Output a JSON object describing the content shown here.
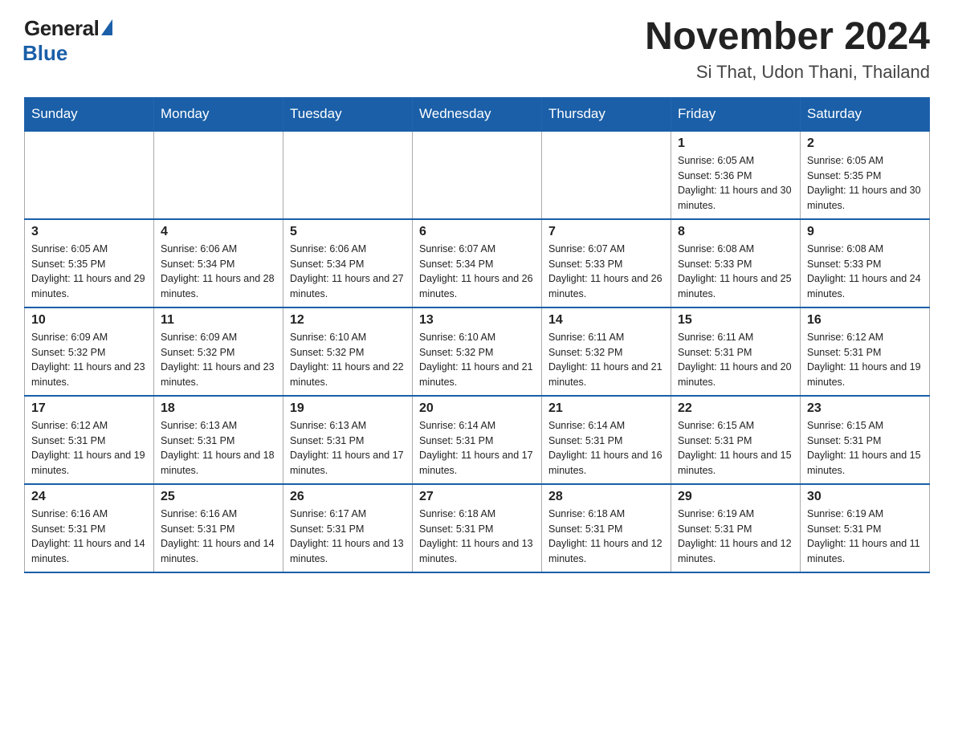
{
  "header": {
    "logo_general": "General",
    "logo_blue": "Blue",
    "month_year": "November 2024",
    "location": "Si That, Udon Thani, Thailand"
  },
  "weekdays": [
    "Sunday",
    "Monday",
    "Tuesday",
    "Wednesday",
    "Thursday",
    "Friday",
    "Saturday"
  ],
  "rows": [
    [
      {
        "day": "",
        "sunrise": "",
        "sunset": "",
        "daylight": ""
      },
      {
        "day": "",
        "sunrise": "",
        "sunset": "",
        "daylight": ""
      },
      {
        "day": "",
        "sunrise": "",
        "sunset": "",
        "daylight": ""
      },
      {
        "day": "",
        "sunrise": "",
        "sunset": "",
        "daylight": ""
      },
      {
        "day": "",
        "sunrise": "",
        "sunset": "",
        "daylight": ""
      },
      {
        "day": "1",
        "sunrise": "Sunrise: 6:05 AM",
        "sunset": "Sunset: 5:36 PM",
        "daylight": "Daylight: 11 hours and 30 minutes."
      },
      {
        "day": "2",
        "sunrise": "Sunrise: 6:05 AM",
        "sunset": "Sunset: 5:35 PM",
        "daylight": "Daylight: 11 hours and 30 minutes."
      }
    ],
    [
      {
        "day": "3",
        "sunrise": "Sunrise: 6:05 AM",
        "sunset": "Sunset: 5:35 PM",
        "daylight": "Daylight: 11 hours and 29 minutes."
      },
      {
        "day": "4",
        "sunrise": "Sunrise: 6:06 AM",
        "sunset": "Sunset: 5:34 PM",
        "daylight": "Daylight: 11 hours and 28 minutes."
      },
      {
        "day": "5",
        "sunrise": "Sunrise: 6:06 AM",
        "sunset": "Sunset: 5:34 PM",
        "daylight": "Daylight: 11 hours and 27 minutes."
      },
      {
        "day": "6",
        "sunrise": "Sunrise: 6:07 AM",
        "sunset": "Sunset: 5:34 PM",
        "daylight": "Daylight: 11 hours and 26 minutes."
      },
      {
        "day": "7",
        "sunrise": "Sunrise: 6:07 AM",
        "sunset": "Sunset: 5:33 PM",
        "daylight": "Daylight: 11 hours and 26 minutes."
      },
      {
        "day": "8",
        "sunrise": "Sunrise: 6:08 AM",
        "sunset": "Sunset: 5:33 PM",
        "daylight": "Daylight: 11 hours and 25 minutes."
      },
      {
        "day": "9",
        "sunrise": "Sunrise: 6:08 AM",
        "sunset": "Sunset: 5:33 PM",
        "daylight": "Daylight: 11 hours and 24 minutes."
      }
    ],
    [
      {
        "day": "10",
        "sunrise": "Sunrise: 6:09 AM",
        "sunset": "Sunset: 5:32 PM",
        "daylight": "Daylight: 11 hours and 23 minutes."
      },
      {
        "day": "11",
        "sunrise": "Sunrise: 6:09 AM",
        "sunset": "Sunset: 5:32 PM",
        "daylight": "Daylight: 11 hours and 23 minutes."
      },
      {
        "day": "12",
        "sunrise": "Sunrise: 6:10 AM",
        "sunset": "Sunset: 5:32 PM",
        "daylight": "Daylight: 11 hours and 22 minutes."
      },
      {
        "day": "13",
        "sunrise": "Sunrise: 6:10 AM",
        "sunset": "Sunset: 5:32 PM",
        "daylight": "Daylight: 11 hours and 21 minutes."
      },
      {
        "day": "14",
        "sunrise": "Sunrise: 6:11 AM",
        "sunset": "Sunset: 5:32 PM",
        "daylight": "Daylight: 11 hours and 21 minutes."
      },
      {
        "day": "15",
        "sunrise": "Sunrise: 6:11 AM",
        "sunset": "Sunset: 5:31 PM",
        "daylight": "Daylight: 11 hours and 20 minutes."
      },
      {
        "day": "16",
        "sunrise": "Sunrise: 6:12 AM",
        "sunset": "Sunset: 5:31 PM",
        "daylight": "Daylight: 11 hours and 19 minutes."
      }
    ],
    [
      {
        "day": "17",
        "sunrise": "Sunrise: 6:12 AM",
        "sunset": "Sunset: 5:31 PM",
        "daylight": "Daylight: 11 hours and 19 minutes."
      },
      {
        "day": "18",
        "sunrise": "Sunrise: 6:13 AM",
        "sunset": "Sunset: 5:31 PM",
        "daylight": "Daylight: 11 hours and 18 minutes."
      },
      {
        "day": "19",
        "sunrise": "Sunrise: 6:13 AM",
        "sunset": "Sunset: 5:31 PM",
        "daylight": "Daylight: 11 hours and 17 minutes."
      },
      {
        "day": "20",
        "sunrise": "Sunrise: 6:14 AM",
        "sunset": "Sunset: 5:31 PM",
        "daylight": "Daylight: 11 hours and 17 minutes."
      },
      {
        "day": "21",
        "sunrise": "Sunrise: 6:14 AM",
        "sunset": "Sunset: 5:31 PM",
        "daylight": "Daylight: 11 hours and 16 minutes."
      },
      {
        "day": "22",
        "sunrise": "Sunrise: 6:15 AM",
        "sunset": "Sunset: 5:31 PM",
        "daylight": "Daylight: 11 hours and 15 minutes."
      },
      {
        "day": "23",
        "sunrise": "Sunrise: 6:15 AM",
        "sunset": "Sunset: 5:31 PM",
        "daylight": "Daylight: 11 hours and 15 minutes."
      }
    ],
    [
      {
        "day": "24",
        "sunrise": "Sunrise: 6:16 AM",
        "sunset": "Sunset: 5:31 PM",
        "daylight": "Daylight: 11 hours and 14 minutes."
      },
      {
        "day": "25",
        "sunrise": "Sunrise: 6:16 AM",
        "sunset": "Sunset: 5:31 PM",
        "daylight": "Daylight: 11 hours and 14 minutes."
      },
      {
        "day": "26",
        "sunrise": "Sunrise: 6:17 AM",
        "sunset": "Sunset: 5:31 PM",
        "daylight": "Daylight: 11 hours and 13 minutes."
      },
      {
        "day": "27",
        "sunrise": "Sunrise: 6:18 AM",
        "sunset": "Sunset: 5:31 PM",
        "daylight": "Daylight: 11 hours and 13 minutes."
      },
      {
        "day": "28",
        "sunrise": "Sunrise: 6:18 AM",
        "sunset": "Sunset: 5:31 PM",
        "daylight": "Daylight: 11 hours and 12 minutes."
      },
      {
        "day": "29",
        "sunrise": "Sunrise: 6:19 AM",
        "sunset": "Sunset: 5:31 PM",
        "daylight": "Daylight: 11 hours and 12 minutes."
      },
      {
        "day": "30",
        "sunrise": "Sunrise: 6:19 AM",
        "sunset": "Sunset: 5:31 PM",
        "daylight": "Daylight: 11 hours and 11 minutes."
      }
    ]
  ]
}
